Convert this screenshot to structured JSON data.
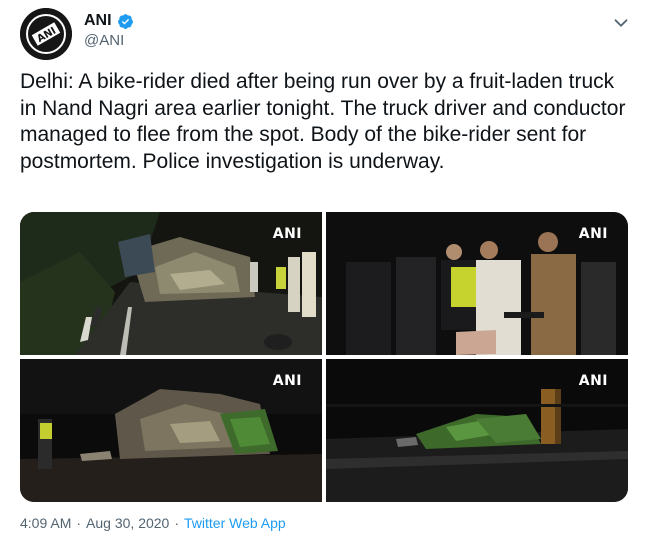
{
  "author": {
    "name": "ANI",
    "handle": "@ANI",
    "avatar_logo": "ANI"
  },
  "tweet": {
    "text": "Delhi: A bike-rider died after being run over by a fruit-laden truck in Nand Nagri area earlier tonight. The truck driver and conductor managed to flee from the spot. Body of the bike-rider sent for postmortem. Police investigation is underway.",
    "watermark": "ANI"
  },
  "meta": {
    "time": "4:09 AM",
    "separator": "·",
    "date": "Aug 30, 2020",
    "source": "Twitter Web App"
  },
  "icons": {
    "verified": "verified-badge-icon",
    "more": "chevron-down-icon"
  },
  "colors": {
    "link": "#1d9bf0",
    "verified": "#1d9bf0",
    "secondary_text": "#536471"
  }
}
